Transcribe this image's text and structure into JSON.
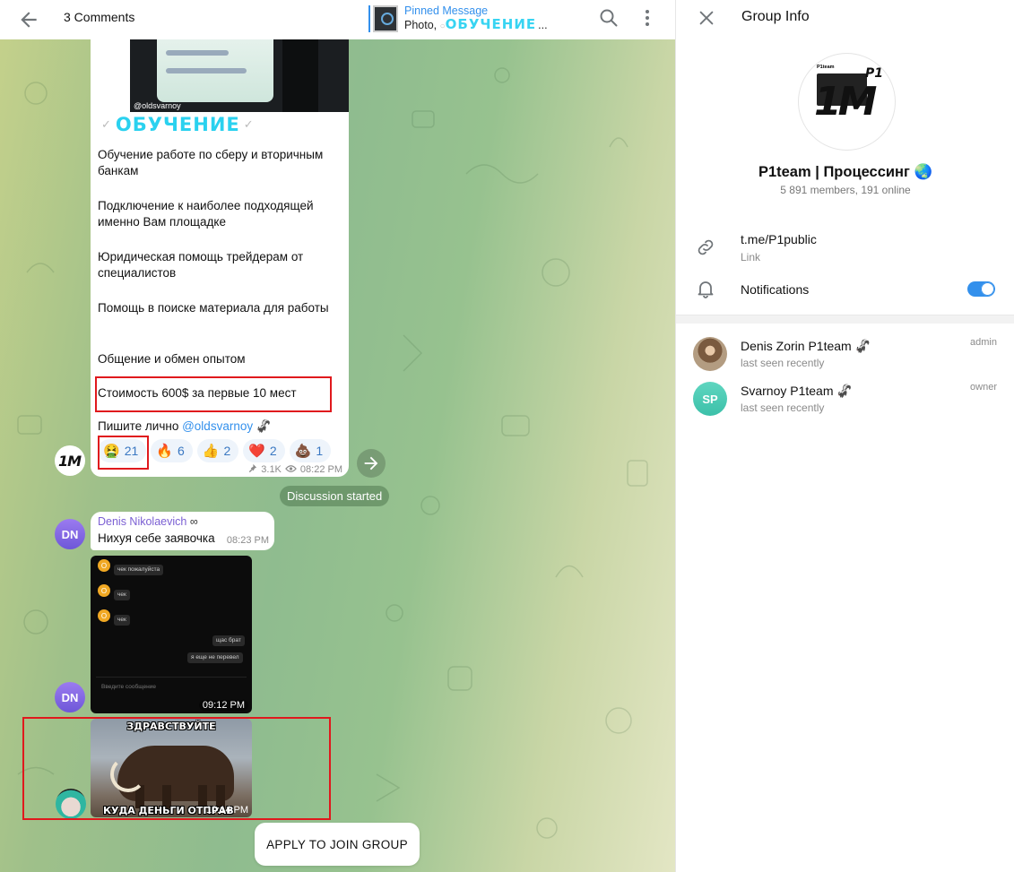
{
  "chat": {
    "header": {
      "title": "3 Comments",
      "pinned_title": "Pinned Message",
      "pinned_prefix": "Photo,",
      "pinned_highlight": "ОБУЧЕНИЕ",
      "pinned_ellipsis": "..."
    },
    "post": {
      "image_tag": "@oldsvarnoy",
      "heading": "ОБУЧЕНИЕ",
      "lines": [
        "Обучение работе по сберу и вторичным банкам",
        "Подключение к наиболее подходящей именно Вам площадке",
        "Юридическая помощь трейдерам от специалистов",
        "Помощь в поиске материала для работы",
        "Общение и обмен опытом",
        "Стоимость 600$ за первые 10 мест"
      ],
      "contact_prefix": "Пишите лично",
      "contact_mention": "@oldsvarnoy",
      "reactions": [
        {
          "emoji": "🤮",
          "count": "21"
        },
        {
          "emoji": "🔥",
          "count": "6"
        },
        {
          "emoji": "👍",
          "count": "2"
        },
        {
          "emoji": "❤️",
          "count": "2"
        },
        {
          "emoji": "💩",
          "count": "1"
        }
      ],
      "views": "3.1K",
      "time": "08:22 PM"
    },
    "channel_avatar_text": "1M",
    "discussion_label": "Discussion started",
    "messages": [
      {
        "avatar": "DN",
        "sender": "Denis Nikolaevich",
        "text": "Нихуя себе заявочка",
        "time": "08:23 PM"
      },
      {
        "avatar": "DN",
        "screenshot_lines": [
          "чек пожалуйста",
          "чек",
          "чек"
        ],
        "screenshot_replies": [
          "щас брат",
          "я еще не перевел"
        ],
        "screenshot_input": "Введите сообщение",
        "time": "09:12 PM"
      },
      {
        "caption_top": "ЗДРАВСТВУЙТЕ",
        "caption_bottom": "КУДА ДЕНЬГИ ОТПРАВ",
        "time": "10:14 PM"
      }
    ],
    "join_button": "APPLY TO JOIN GROUP"
  },
  "info": {
    "title": "Group Info",
    "photo_tag": "P1team",
    "photo_letters": "1M",
    "photo_top": "P1",
    "name": "P1team | Процессинг 🌏",
    "members": "5 891 members, 191 online",
    "link": "t.me/P1public",
    "link_label": "Link",
    "notifications_label": "Notifications",
    "notifications_on": true,
    "admins": [
      {
        "name": "Denis Zorin P1team 🦨",
        "status": "last seen recently",
        "role": "admin",
        "initials": ""
      },
      {
        "name": "Svarnoy P1team 🦨",
        "status": "last seen recently",
        "role": "owner",
        "initials": "SP"
      }
    ]
  }
}
